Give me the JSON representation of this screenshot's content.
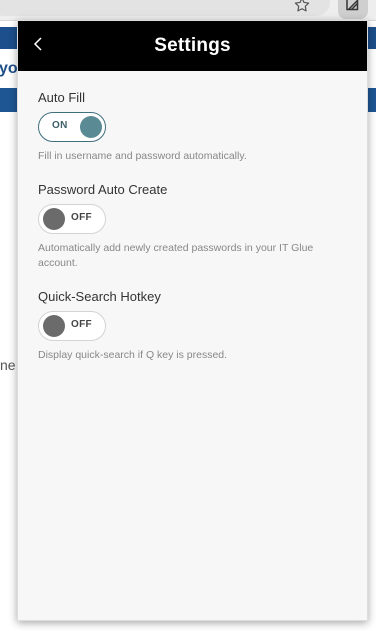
{
  "browser": {
    "bookmark_icon": "star-icon",
    "extension_icon": "it-glue-extension-icon"
  },
  "background_page": {
    "fragment_top": "yo",
    "fragment_mid": "ne"
  },
  "popup": {
    "title": "Settings",
    "back_icon": "chevron-left-icon",
    "settings": [
      {
        "label": "Auto Fill",
        "state": "ON",
        "enabled": true,
        "description": "Fill in username and password automatically."
      },
      {
        "label": "Password Auto Create",
        "state": "OFF",
        "enabled": false,
        "description": "Automatically add newly created passwords in your IT Glue account."
      },
      {
        "label": "Quick-Search Hotkey",
        "state": "OFF",
        "enabled": false,
        "description": "Display quick-search if Q key is pressed."
      }
    ]
  },
  "colors": {
    "header_bg": "#000000",
    "toggle_on": "#5a8a94",
    "toggle_off_knob": "#6b6b6b",
    "page_blue": "#1d4f8c"
  }
}
